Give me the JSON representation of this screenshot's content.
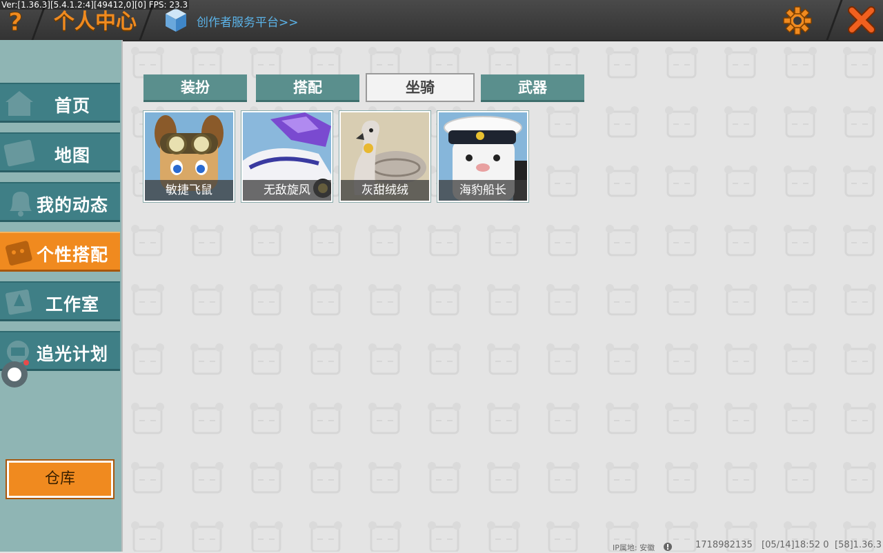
{
  "version_text": "Ver:[1.36.3][5.4.1.2:4][49412,0][0] FPS: 23.3",
  "header": {
    "title": "个人中心",
    "creator_link": "创作者服务平台>>",
    "accent": "#f08a1f"
  },
  "sidebar": {
    "items": [
      {
        "label": "首页",
        "icon": "home-icon",
        "active": false
      },
      {
        "label": "地图",
        "icon": "map-icon",
        "active": false
      },
      {
        "label": "我的动态",
        "icon": "bell-icon",
        "active": false
      },
      {
        "label": "个性搭配",
        "icon": "outfit-icon",
        "active": true
      },
      {
        "label": "工作室",
        "icon": "studio-icon",
        "active": false
      },
      {
        "label": "追光计划",
        "icon": "spotlight-icon",
        "active": false
      }
    ],
    "warehouse_label": "仓库"
  },
  "tabs": [
    {
      "label": "装扮",
      "active": false
    },
    {
      "label": "搭配",
      "active": false
    },
    {
      "label": "坐骑",
      "active": true
    },
    {
      "label": "武器",
      "active": false
    }
  ],
  "mounts": [
    {
      "name": "敏捷飞鼠",
      "icon": "flying-squirrel-icon"
    },
    {
      "name": "无敌旋风",
      "icon": "race-car-icon"
    },
    {
      "name": "灰甜绒绒",
      "icon": "gray-swan-icon"
    },
    {
      "name": "海豹船长",
      "icon": "seal-captain-icon"
    }
  ],
  "footer": {
    "ip_location": "IP属地: 安徽",
    "uid": "1718982135",
    "timestamp": "[05/14]18:52 0",
    "build": "[58]1.36.3"
  }
}
